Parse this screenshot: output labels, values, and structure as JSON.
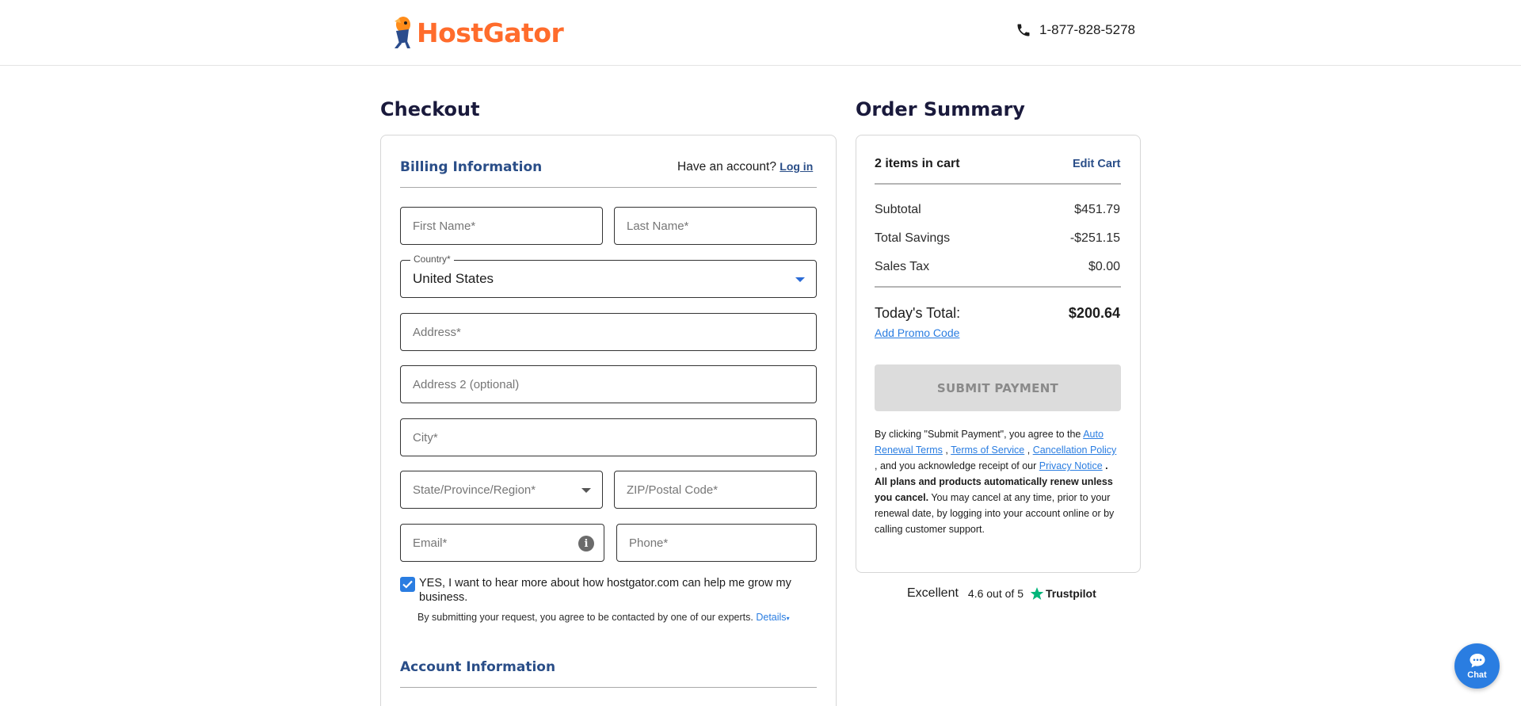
{
  "header": {
    "logo_text": "HostGator",
    "phone": "1-877-828-5278"
  },
  "checkout": {
    "title": "Checkout",
    "billing": {
      "title": "Billing Information",
      "account_prompt": "Have an account?",
      "login_link": "Log in",
      "first_name_placeholder": "First Name*",
      "last_name_placeholder": "Last Name*",
      "country_label": "Country*",
      "country_value": "United States",
      "address_placeholder": "Address*",
      "address2_placeholder": "Address 2 (optional)",
      "city_placeholder": "City*",
      "state_placeholder": "State/Province/Region*",
      "zip_placeholder": "ZIP/Postal Code*",
      "email_placeholder": "Email*",
      "phone_placeholder": "Phone*",
      "optin_label": "YES, I want to hear more about how hostgator.com can help me grow my business.",
      "optin_checked": true,
      "consent_text": "By submitting your request, you agree to be contacted by one of our experts.",
      "details_link": "Details"
    },
    "account": {
      "title": "Account Information"
    }
  },
  "summary": {
    "title": "Order Summary",
    "items_in_cart": "2 items in cart",
    "edit_cart": "Edit Cart",
    "subtotal_label": "Subtotal",
    "subtotal_value": "$451.79",
    "savings_label": "Total Savings",
    "savings_value": "-$251.15",
    "tax_label": "Sales Tax",
    "tax_value": "$0.00",
    "total_label": "Today's Total:",
    "total_value": "$200.64",
    "promo_link": "Add Promo Code",
    "submit_label": "SUBMIT PAYMENT",
    "legal": {
      "intro": "By clicking \"Submit Payment\", you agree to the",
      "auto_renewal": "Auto Renewal Terms",
      "sep1": ",",
      "tos": "Terms of Service",
      "sep2": ",",
      "cancellation": "Cancellation Policy",
      "ack": ", and you acknowledge receipt of our",
      "privacy": "Privacy Notice",
      "bold": ". All plans and products automatically renew unless you cancel.",
      "rest": "You may cancel at any time, prior to your renewal date, by logging into your account online or by calling customer support."
    }
  },
  "trustpilot": {
    "rating_word": "Excellent",
    "score_text": "4.6 out of 5",
    "brand": "Trustpilot"
  },
  "chat": {
    "label": "Chat"
  },
  "colors": {
    "brand_orange": "#ff6c2c",
    "link_blue": "#2a7de1",
    "section_blue": "#2a4e88",
    "trustpilot_green": "#00b67a"
  }
}
